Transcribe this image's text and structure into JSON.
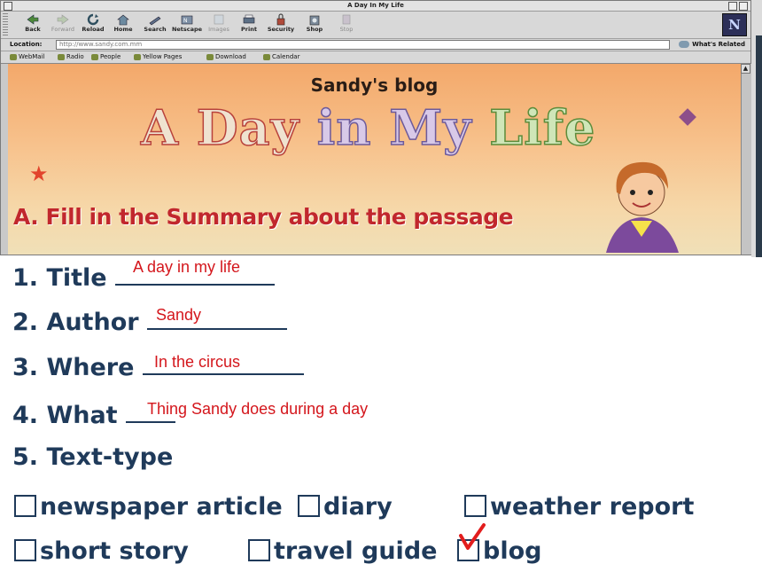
{
  "browser": {
    "window_title": "A Day In My Life",
    "toolbar": [
      {
        "label": "Back",
        "icon": "back-arrow-icon",
        "enabled": true
      },
      {
        "label": "Forward",
        "icon": "forward-arrow-icon",
        "enabled": false
      },
      {
        "label": "Reload",
        "icon": "reload-icon",
        "enabled": true
      },
      {
        "label": "Home",
        "icon": "home-icon",
        "enabled": true
      },
      {
        "label": "Search",
        "icon": "search-icon",
        "enabled": true
      },
      {
        "label": "Netscape",
        "icon": "netscape-icon",
        "enabled": true
      },
      {
        "label": "Images",
        "icon": "images-icon",
        "enabled": false
      },
      {
        "label": "Print",
        "icon": "print-icon",
        "enabled": true
      },
      {
        "label": "Security",
        "icon": "lock-icon",
        "enabled": true
      },
      {
        "label": "Shop",
        "icon": "shop-icon",
        "enabled": true
      },
      {
        "label": "Stop",
        "icon": "stop-icon",
        "enabled": false
      }
    ],
    "location_label": "Location:",
    "url": "http://www.sandy.com.mm",
    "related_label": "What's Related",
    "bookmarks": [
      "WebMail",
      "Radio",
      "People",
      "Yellow Pages",
      "Download",
      "Calendar"
    ],
    "logo_letter": "N"
  },
  "banner": {
    "blog_name": "Sandy's blog",
    "title_words": [
      "A",
      "Day",
      "in",
      "My",
      "Life"
    ],
    "section_heading": "A. Fill in the Summary about the passage"
  },
  "worksheet": {
    "questions": [
      {
        "label": "1. Title",
        "answer": "A day in my life"
      },
      {
        "label": "2. Author",
        "answer": "Sandy"
      },
      {
        "label": "3. Where",
        "answer": "In the circus"
      },
      {
        "label": "4. What",
        "answer": "Thing Sandy does during a day"
      }
    ],
    "text_type_label": "5. Text-type",
    "options": [
      {
        "label": "newspaper article",
        "checked": false
      },
      {
        "label": "diary",
        "checked": false
      },
      {
        "label": "weather report",
        "checked": false
      },
      {
        "label": "short story",
        "checked": false
      },
      {
        "label": "travel guide",
        "checked": false
      },
      {
        "label": "blog",
        "checked": true
      }
    ]
  },
  "colors": {
    "question_text": "#1f3a5a",
    "answer_text": "#d4161c",
    "heading_red": "#c1272d",
    "banner_bg": "#f3a86a"
  }
}
